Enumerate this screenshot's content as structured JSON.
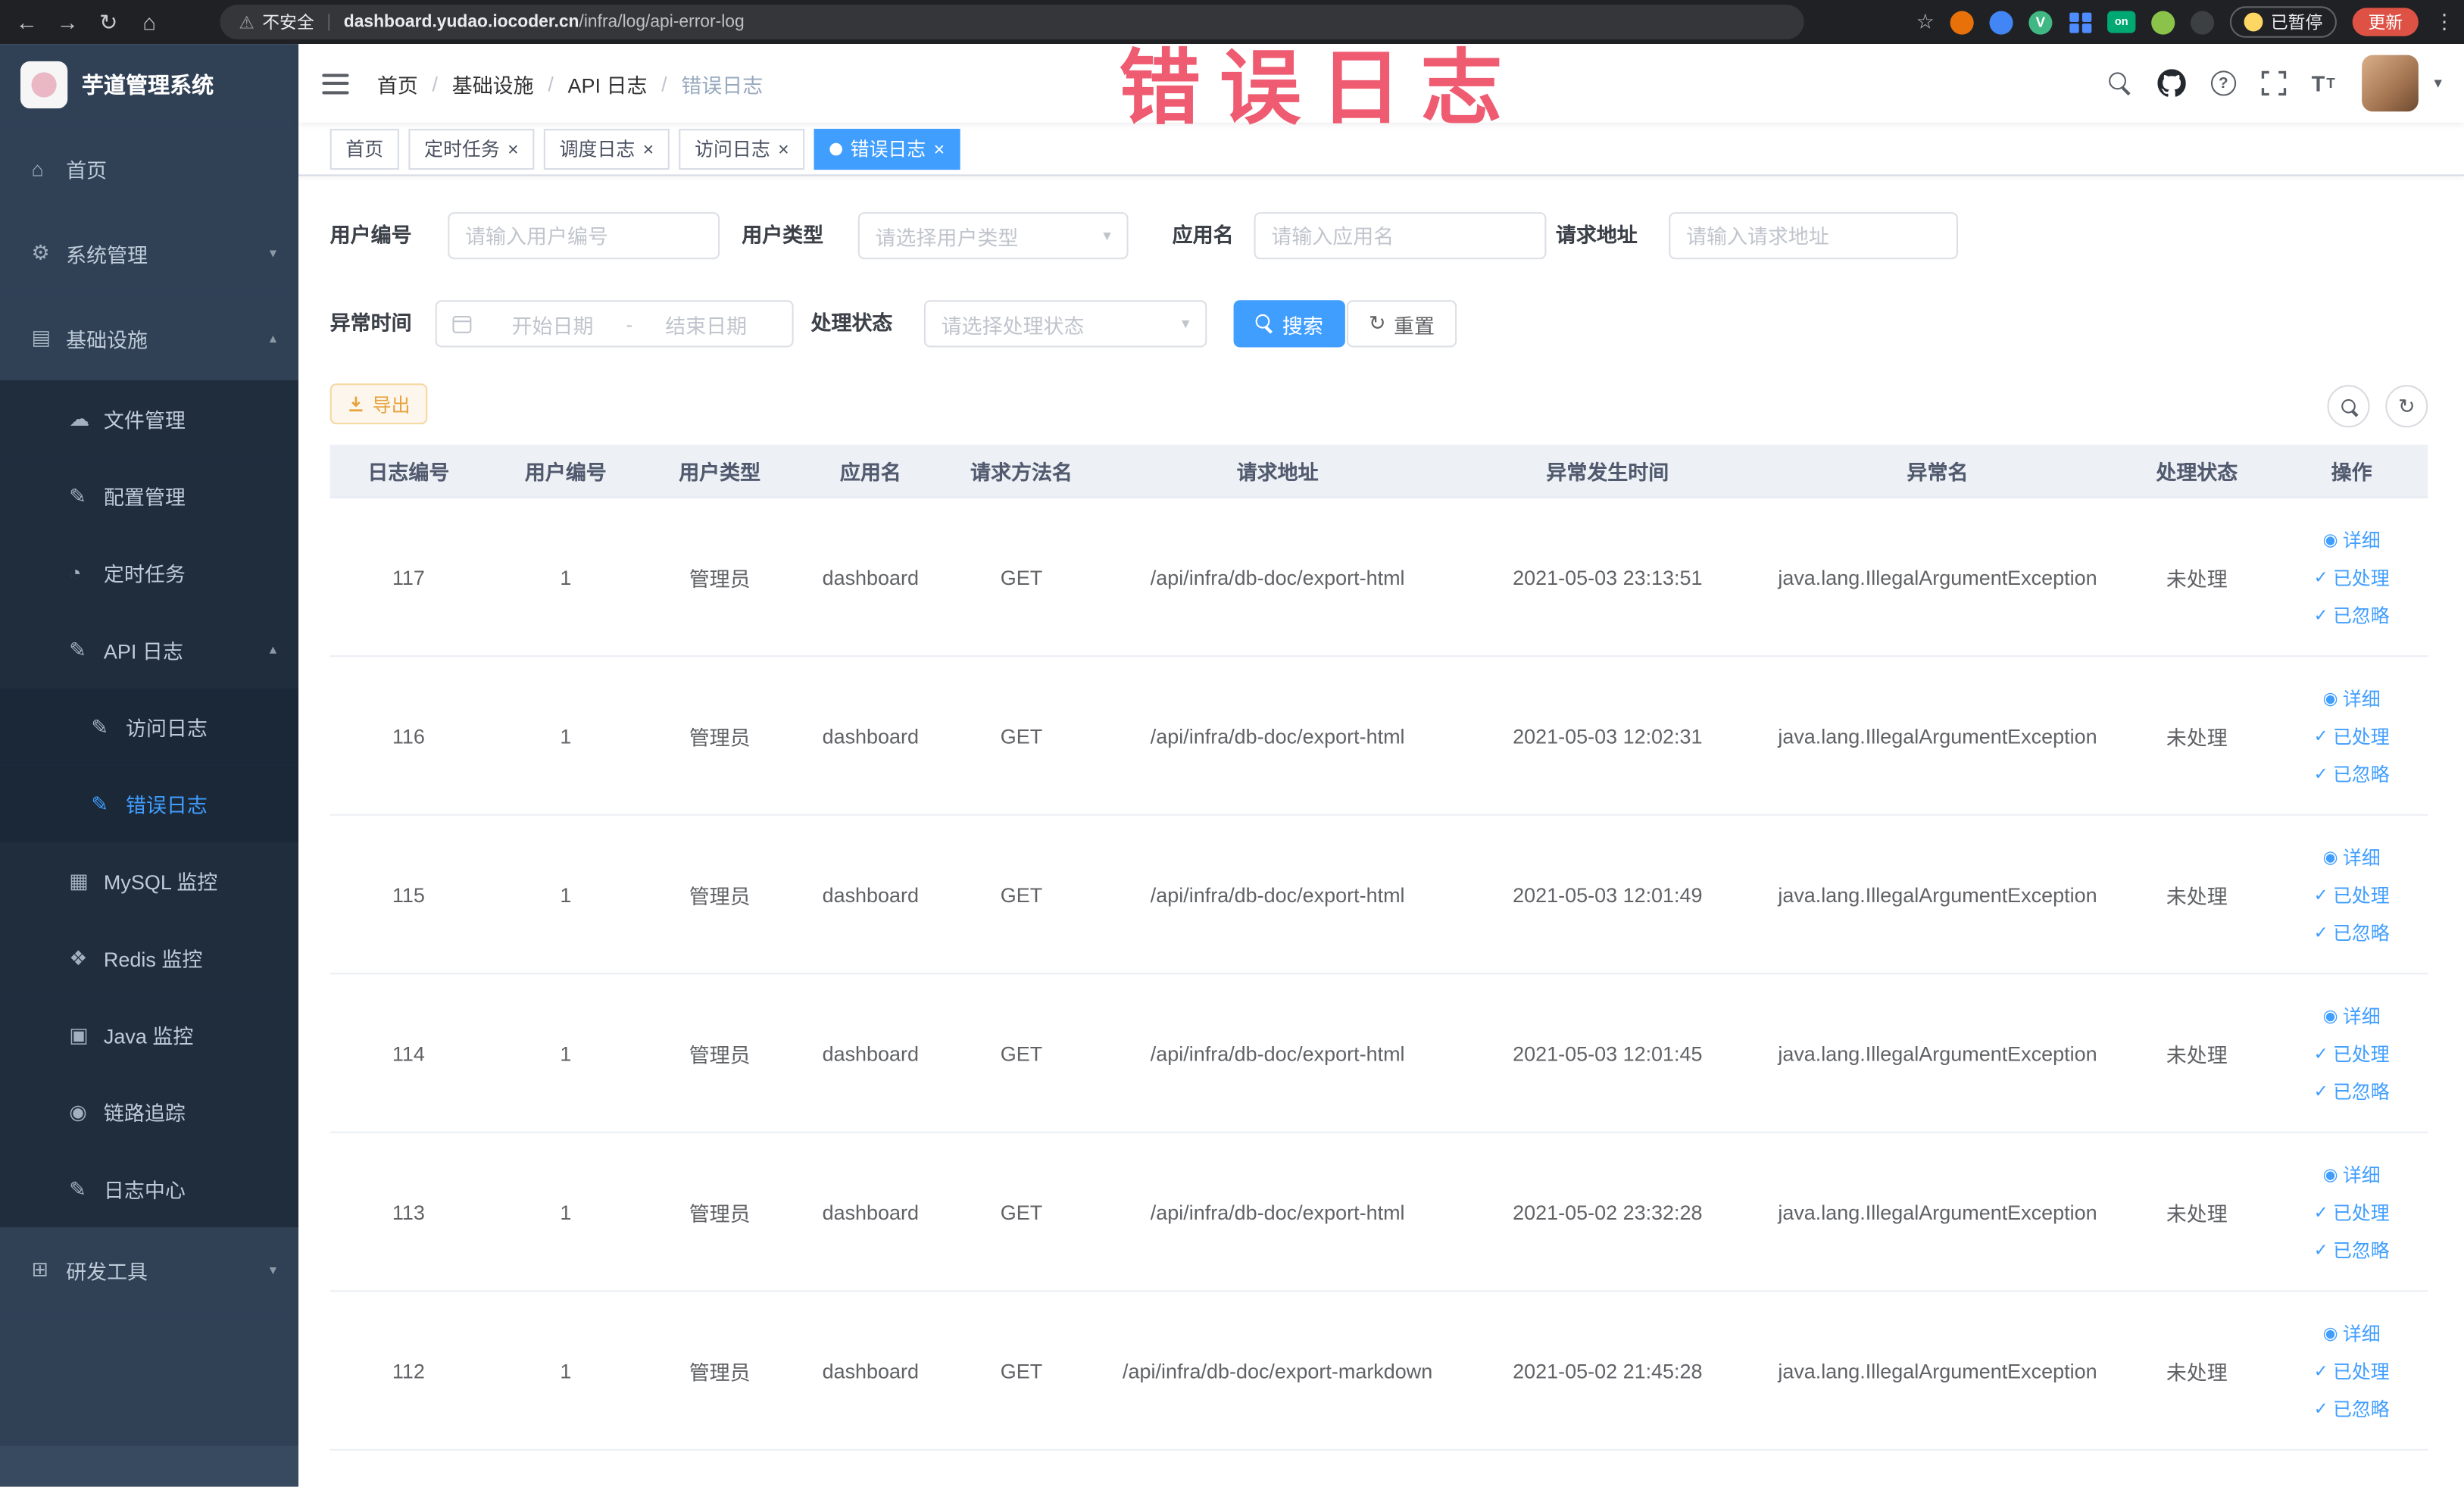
{
  "browser": {
    "security": "不安全",
    "url_domain": "dashboard.yudao.iocoder.cn",
    "url_path": "/infra/log/api-error-log",
    "paused": "已暂停",
    "update": "更新"
  },
  "overlay": {
    "text": "错误日志",
    "color": "#ec3e58"
  },
  "sidebar": {
    "logo_title": "芋道管理系统",
    "menu": [
      {
        "label": "首页",
        "icon": "home-icon",
        "level": 0
      },
      {
        "label": "系统管理",
        "icon": "gear-icon",
        "level": 0,
        "chevron": "down"
      },
      {
        "label": "基础设施",
        "icon": "infra-icon",
        "level": 0,
        "chevron": "up"
      },
      {
        "label": "文件管理",
        "icon": "file-icon",
        "level": 1
      },
      {
        "label": "配置管理",
        "icon": "config-icon",
        "level": 1
      },
      {
        "label": "定时任务",
        "icon": "timer-icon",
        "level": 1
      },
      {
        "label": "API 日志",
        "icon": "api-log-icon",
        "level": 1,
        "chevron": "up"
      },
      {
        "label": "访问日志",
        "icon": "access-log-icon",
        "level": 2
      },
      {
        "label": "错误日志",
        "icon": "error-log-icon",
        "level": 2,
        "active": true
      },
      {
        "label": "MySQL 监控",
        "icon": "mysql-icon",
        "level": 1
      },
      {
        "label": "Redis 监控",
        "icon": "redis-icon",
        "level": 1
      },
      {
        "label": "Java 监控",
        "icon": "java-icon",
        "level": 1
      },
      {
        "label": "链路追踪",
        "icon": "trace-icon",
        "level": 1
      },
      {
        "label": "日志中心",
        "icon": "log-center-icon",
        "level": 1
      },
      {
        "label": "研发工具",
        "icon": "tools-icon",
        "level": 0,
        "chevron": "down"
      }
    ]
  },
  "breadcrumb": [
    "首页",
    "基础设施",
    "API 日志",
    "错误日志"
  ],
  "tabs": [
    {
      "label": "首页",
      "closable": false,
      "active": false
    },
    {
      "label": "定时任务",
      "closable": true,
      "active": false
    },
    {
      "label": "调度日志",
      "closable": true,
      "active": false
    },
    {
      "label": "访问日志",
      "closable": true,
      "active": false
    },
    {
      "label": "错误日志",
      "closable": true,
      "active": true
    }
  ],
  "filters": {
    "user_id": {
      "label": "用户编号",
      "placeholder": "请输入用户编号"
    },
    "user_type": {
      "label": "用户类型",
      "placeholder": "请选择用户类型"
    },
    "app_name": {
      "label": "应用名",
      "placeholder": "请输入应用名"
    },
    "request_url": {
      "label": "请求地址",
      "placeholder": "请输入请求地址"
    },
    "exception_time": {
      "label": "异常时间",
      "start_placeholder": "开始日期",
      "separator": "-",
      "end_placeholder": "结束日期"
    },
    "process_status": {
      "label": "处理状态",
      "placeholder": "请选择处理状态"
    },
    "search": "搜索",
    "reset": "重置"
  },
  "toolbar": {
    "export": "导出"
  },
  "table": {
    "columns": [
      "日志编号",
      "用户编号",
      "用户类型",
      "应用名",
      "请求方法名",
      "请求地址",
      "异常发生时间",
      "异常名",
      "处理状态",
      "操作"
    ],
    "actions": [
      {
        "name": "detail",
        "label": "详细",
        "icon": "eye-icon"
      },
      {
        "name": "processed",
        "label": "已处理",
        "icon": "check-icon"
      },
      {
        "name": "ignored",
        "label": "已忽略",
        "icon": "check-icon"
      }
    ],
    "rows": [
      {
        "id": "117",
        "user_id": "1",
        "user_type": "管理员",
        "app": "dashboard",
        "method": "GET",
        "url": "/api/infra/db-doc/export-html",
        "time": "2021-05-03 23:13:51",
        "exception": "java.lang.IllegalArgumentException",
        "status": "未处理"
      },
      {
        "id": "116",
        "user_id": "1",
        "user_type": "管理员",
        "app": "dashboard",
        "method": "GET",
        "url": "/api/infra/db-doc/export-html",
        "time": "2021-05-03 12:02:31",
        "exception": "java.lang.IllegalArgumentException",
        "status": "未处理"
      },
      {
        "id": "115",
        "user_id": "1",
        "user_type": "管理员",
        "app": "dashboard",
        "method": "GET",
        "url": "/api/infra/db-doc/export-html",
        "time": "2021-05-03 12:01:49",
        "exception": "java.lang.IllegalArgumentException",
        "status": "未处理"
      },
      {
        "id": "114",
        "user_id": "1",
        "user_type": "管理员",
        "app": "dashboard",
        "method": "GET",
        "url": "/api/infra/db-doc/export-html",
        "time": "2021-05-03 12:01:45",
        "exception": "java.lang.IllegalArgumentException",
        "status": "未处理"
      },
      {
        "id": "113",
        "user_id": "1",
        "user_type": "管理员",
        "app": "dashboard",
        "method": "GET",
        "url": "/api/infra/db-doc/export-html",
        "time": "2021-05-02 23:32:28",
        "exception": "java.lang.IllegalArgumentException",
        "status": "未处理"
      },
      {
        "id": "112",
        "user_id": "1",
        "user_type": "管理员",
        "app": "dashboard",
        "method": "GET",
        "url": "/api/infra/db-doc/export-markdown",
        "time": "2021-05-02 21:45:28",
        "exception": "java.lang.IllegalArgumentException",
        "status": "未处理"
      }
    ]
  }
}
